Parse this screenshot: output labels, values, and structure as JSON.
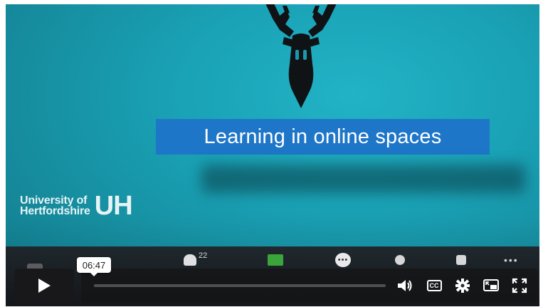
{
  "video": {
    "title_banner": "Learning in online spaces",
    "university_line1": "University of",
    "university_line2": "Hertfordshire",
    "university_mark": "UH"
  },
  "meeting_toolbar": {
    "participants_count": "22",
    "icons": [
      "participants-icon",
      "share-screen-icon",
      "chat-icon",
      "reactions-icon",
      "settings-icon",
      "more-icon"
    ]
  },
  "player": {
    "hover_time": "06:47",
    "controls": {
      "play_icon": "play-icon",
      "volume_icon": "volume-icon",
      "captions_label": "CC",
      "settings_icon": "gear-icon",
      "pip_icon": "picture-in-picture-icon",
      "fullscreen_icon": "fullscreen-icon"
    },
    "accent_color": "#ffffff",
    "banner_color": "#1e76c8"
  }
}
